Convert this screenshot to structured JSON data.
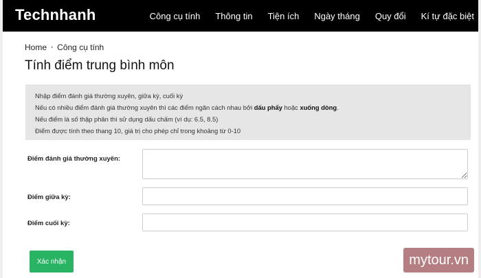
{
  "header": {
    "brand": "Technhanh",
    "nav": [
      {
        "label": "Công cụ tính"
      },
      {
        "label": "Thông tin"
      },
      {
        "label": "Tiện ích"
      },
      {
        "label": "Ngày tháng"
      },
      {
        "label": "Quy đổi"
      },
      {
        "label": "Kí tự đặc biệt"
      }
    ]
  },
  "breadcrumb": {
    "home": "Home",
    "separator": "•",
    "current": "Công cụ tính"
  },
  "page_title": "Tính điểm trung bình môn",
  "info": {
    "line1": "Nhập điểm đánh giá thường xuyên, giữa kỳ, cuối kỳ",
    "line2_prefix": "Nếu có nhiều điểm đánh giá thường xuyên thì các điểm ngăn cách nhau bởi ",
    "line2_bold1": "dấu phẩy",
    "line2_mid": " hoặc ",
    "line2_bold2": "xuống dòng",
    "line2_suffix": ".",
    "line3": "Nếu điểm là số thập phân thì sử dụng dấu chấm (ví dụ: 6.5, 8.5)",
    "line4": "Điểm được tính theo thang 10, giá trị cho phép chỉ trong khoảng từ 0-10"
  },
  "form": {
    "regular_label": "Điểm đánh giá thường xuyên:",
    "regular_value": "",
    "midterm_label": "Điểm giữa kỳ:",
    "midterm_value": "",
    "final_label": "Điểm cuối kỳ:",
    "final_value": "",
    "submit_label": "Xác nhận"
  },
  "watermark": "mytour.vn"
}
